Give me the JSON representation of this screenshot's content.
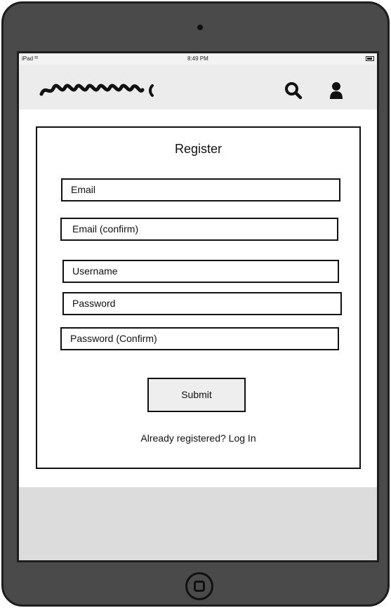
{
  "status_bar": {
    "carrier": "iPad",
    "time": "8:49 PM"
  },
  "header": {
    "logo_icon": "scribble-logo",
    "search_icon": "search-icon",
    "user_icon": "user-icon"
  },
  "register": {
    "title": "Register",
    "fields": {
      "email": "Email",
      "email_confirm": "Email (confirm)",
      "username": "Username",
      "password": "Password",
      "password_confirm": "Password (Confirm)"
    },
    "submit_label": "Submit",
    "login_text": "Already registered? Log In"
  },
  "colors": {
    "device": "#4a4a4a",
    "header_bg": "#ececec",
    "footer_bg": "#dcdcdc",
    "button_bg": "#eeeeee"
  }
}
